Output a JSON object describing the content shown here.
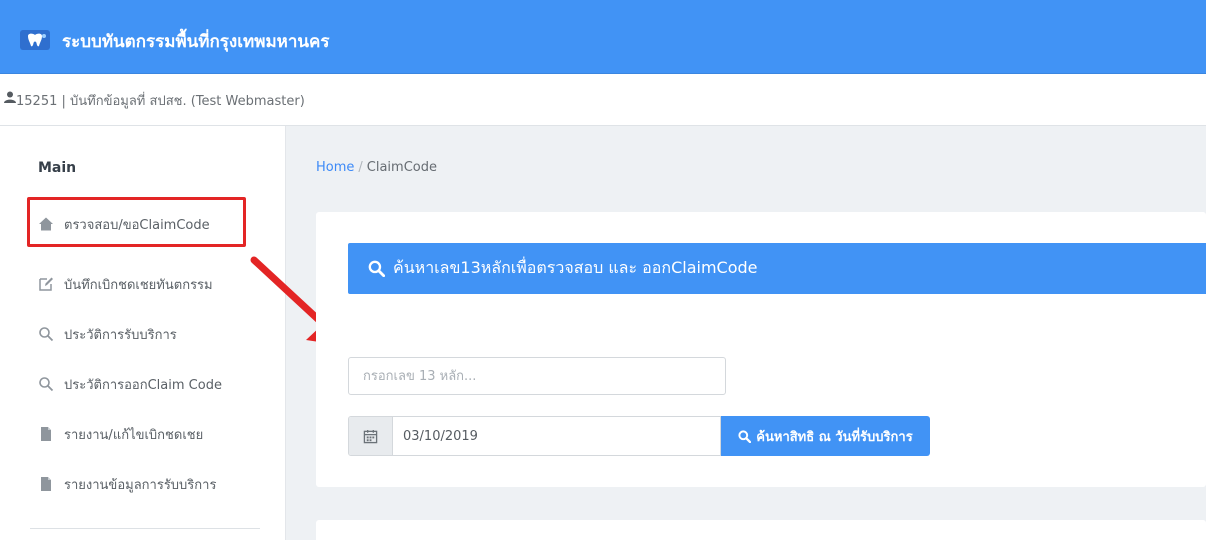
{
  "app": {
    "title": "ระบบทันตกรรมพื้นที่กรุงเทพมหานคร"
  },
  "user": {
    "text": "15251 | บันทึกข้อมูลที่ สปสช. (Test Webmaster)"
  },
  "sidebar": {
    "section_title": "Main",
    "items": [
      {
        "label": "ตรวจสอบ/ขอClaimCode",
        "icon": "home-icon"
      },
      {
        "label": "บันทึกเบิกชดเชยทันตกรรม",
        "icon": "edit-icon"
      },
      {
        "label": "ประวัติการรับบริการ",
        "icon": "search-icon"
      },
      {
        "label": "ประวัติการออกClaim Code",
        "icon": "search-icon"
      },
      {
        "label": "รายงาน/แก้ไขเบิกชดเชย",
        "icon": "file-icon"
      },
      {
        "label": "รายงานข้อมูลการรับบริการ",
        "icon": "file-icon"
      }
    ]
  },
  "breadcrumb": {
    "home": "Home",
    "separator": "/",
    "current": "ClaimCode"
  },
  "search": {
    "header": "ค้นหาเลข13หลักเพื่อตรวจสอบ และ ออกClaimCode",
    "id_placeholder": "กรอกเลข 13 หลัก...",
    "date_value": "03/10/2019",
    "button_label": "ค้นหาสิทธิ ณ วันที่รับบริการ"
  },
  "colors": {
    "primary": "#4193f5",
    "annotation": "#e32525"
  }
}
